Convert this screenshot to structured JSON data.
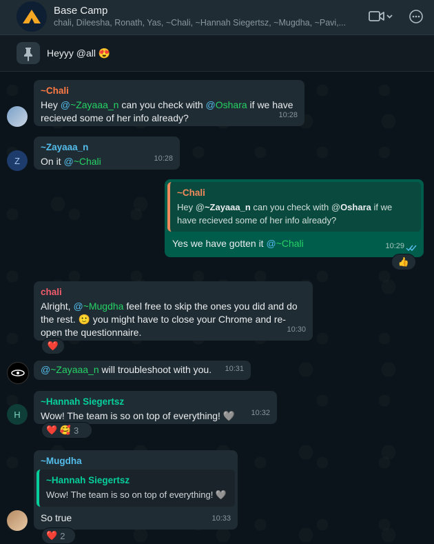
{
  "header": {
    "title": "Base Camp",
    "members": "chali, Dileesha, Ronath, Yas, ~Chali, ~Hannah Siegertsz, ~Mugdha, ~Pavi,..."
  },
  "pinned": {
    "text": "Heyyy @all 😍"
  },
  "messages": {
    "m1": {
      "sender": "~Chali",
      "t1": "Hey ",
      "at1": "@",
      "mention1": "~Zayaaa_n",
      "t2": " can you check with ",
      "at2": "@",
      "mention2": "Oshara",
      "t3": " if we have recieved some of her info already?",
      "time": "10:28"
    },
    "m2": {
      "sender": "~Zayaaa_n",
      "t1": "On it ",
      "at1": "@",
      "mention1": "~Chali",
      "time": "10:28"
    },
    "m3": {
      "quote_sender": "~Chali",
      "quote_t1": "Hey @",
      "quote_mention1": "~Zayaaa_n",
      "quote_t2": " can you check with @",
      "quote_mention2": "Oshara",
      "quote_t3": " if we have recieved some of her info already?",
      "t1": "Yes we have gotten it ",
      "at1": "@",
      "mention1": "~Chali",
      "time": "10:29",
      "reaction": "👍"
    },
    "m4": {
      "sender": "chali",
      "t1": "Alright, ",
      "at1": "@",
      "mention1": "~Mugdha",
      "t2": " feel free to skip the ones you did and do the rest. 🙂 you might have to close your Chrome and re-open the questionnaire.",
      "time": "10:30",
      "reaction": "❤️"
    },
    "m5": {
      "at1": "@",
      "mention1": "~Zayaaa_n",
      "t1": " will troubleshoot with you.",
      "time": "10:31"
    },
    "m6": {
      "sender": "~Hannah Siegertsz",
      "t1": "Wow! The team is so on top of everything! 🩶",
      "time": "10:32",
      "reaction_emojis": "❤️ 🥰",
      "reaction_count": "3"
    },
    "m7": {
      "sender": "~Mugdha",
      "quote_sender": "~Hannah Siegertsz",
      "quote_text": "Wow! The team is so on top of everything! 🩶",
      "t1": "So true",
      "time": "10:33",
      "reaction_emoji": "❤️",
      "reaction_count": "2"
    }
  },
  "avatars": {
    "zayaaa": "Z",
    "hannah": "H"
  },
  "colors": {
    "chali_name": "#ff7a45",
    "zayaaa_name": "#53bdeb",
    "chali_lower_name": "#f15c6d",
    "hannah_name": "#06cf9c",
    "mugdha_name": "#53bdeb",
    "quote_bar_out": "#f08a5d",
    "quote_bar_hannah": "#06cf9c",
    "read_ticks": "#53bdeb"
  }
}
